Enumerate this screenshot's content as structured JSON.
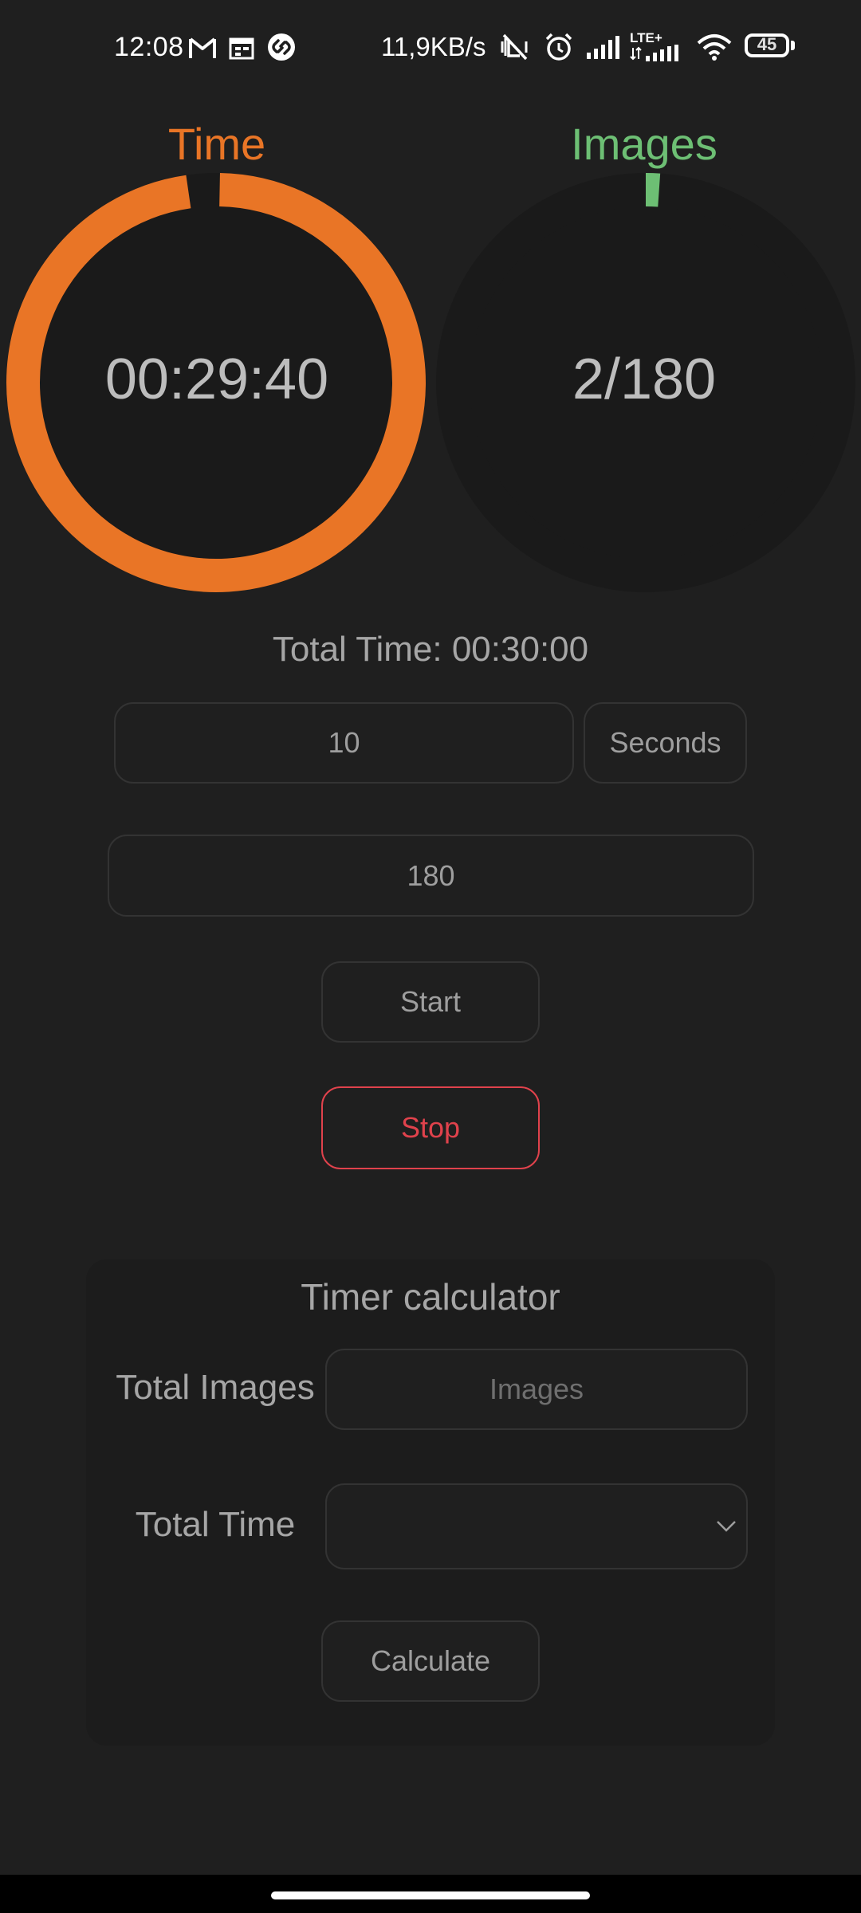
{
  "status_bar": {
    "time": "12:08",
    "net_speed": "11,9KB/s",
    "lte_label": "LTE+",
    "battery": "45",
    "icons": [
      "gmail-icon",
      "calendar-icon",
      "shazam-icon",
      "vibrate-mute-icon",
      "alarm-icon",
      "signal-icon",
      "lte-signal-icon",
      "wifi-icon",
      "battery-icon"
    ]
  },
  "gauges": {
    "time": {
      "label": "Time",
      "value": "00:29:40",
      "progress": 0.989,
      "color": "#e97526"
    },
    "images": {
      "label": "Images",
      "value": "2/180",
      "progress": 0.011,
      "color": "#6dbf74"
    }
  },
  "total_time_text": "Total Time: 00:30:00",
  "interval_input": {
    "value": "10"
  },
  "unit_select": {
    "value": "Seconds"
  },
  "images_input": {
    "value": "180"
  },
  "start_button": "Start",
  "stop_button": "Stop",
  "calculator": {
    "title": "Timer calculator",
    "total_images_label": "Total Images",
    "total_images_placeholder": "Images",
    "total_time_label": "Total Time",
    "total_time_value": "",
    "calculate_button": "Calculate"
  },
  "colors": {
    "background": "#1f1f1f",
    "accent_time": "#e97526",
    "accent_images": "#6dbf74",
    "stop": "#e0424c"
  }
}
